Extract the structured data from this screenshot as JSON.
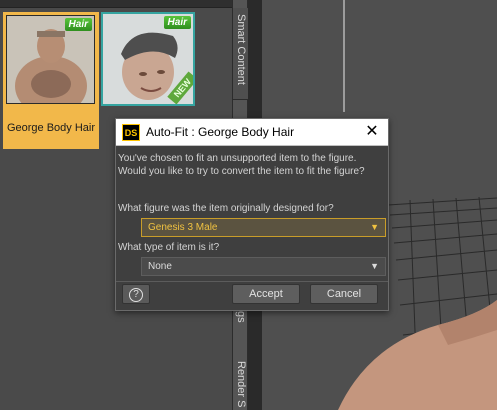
{
  "library": {
    "tiles": [
      {
        "label": "George Body Hair",
        "badge": "Hair",
        "selected": true
      },
      {
        "label": "",
        "badge": "Hair",
        "ribbon": "NEW",
        "selected": false
      }
    ]
  },
  "tabs": {
    "smart_content": "Smart Content",
    "partial": "gs",
    "render": "Render S"
  },
  "dialog": {
    "logo": "DS",
    "title": "Auto-Fit : George Body Hair",
    "close_icon": "✕",
    "message_line1": "You've chosen to fit an unsupported item to the figure.",
    "message_line2": "Would you like to try to convert the item to fit the figure?",
    "question1": "What figure was the item originally designed for?",
    "figure_value": "Genesis 3 Male",
    "question2": "What type of item is it?",
    "type_value": "None",
    "help_label": "?",
    "accept_label": "Accept",
    "cancel_label": "Cancel"
  },
  "colors": {
    "accent": "#f2b84a",
    "badge_green": "#4caf2f",
    "select_highlight": "#c99d29"
  }
}
